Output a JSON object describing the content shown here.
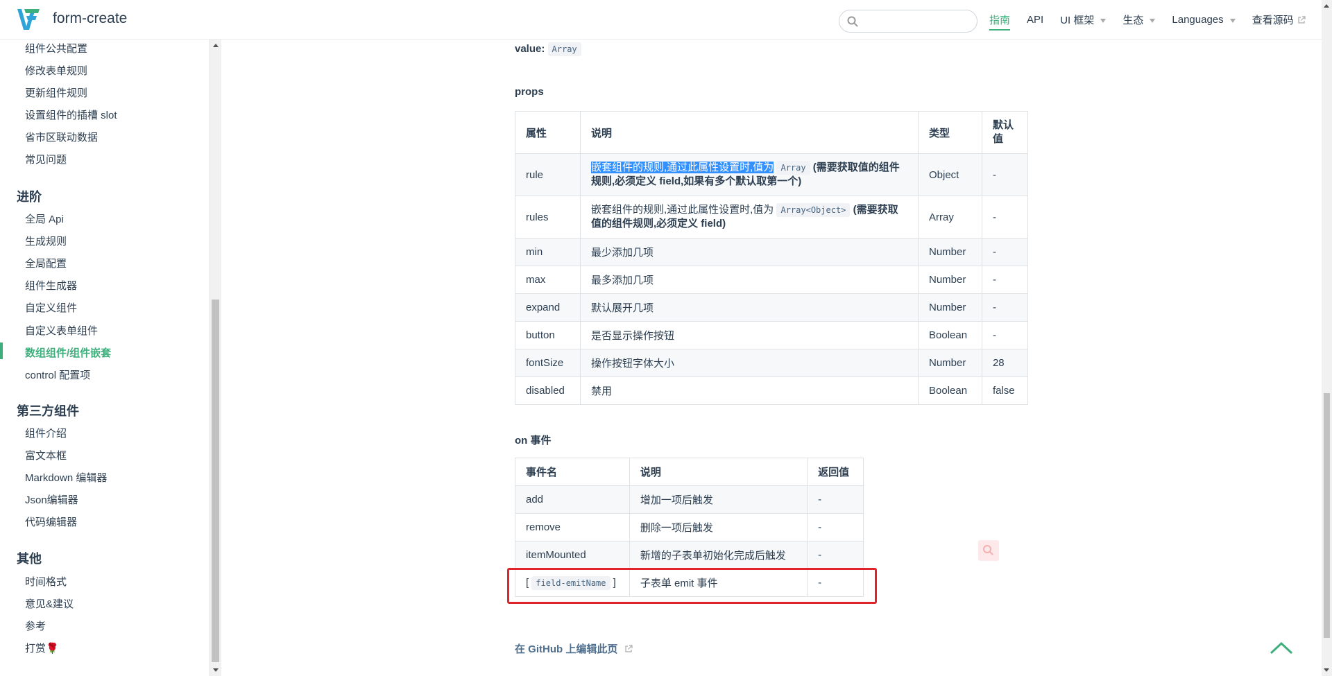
{
  "header": {
    "site_name": "form-create",
    "search_placeholder": "",
    "nav": [
      {
        "label": "指南",
        "active": true,
        "dropdown": false
      },
      {
        "label": "API",
        "active": false,
        "dropdown": false
      },
      {
        "label": "UI 框架",
        "active": false,
        "dropdown": true
      },
      {
        "label": "生态",
        "active": false,
        "dropdown": true
      },
      {
        "label": "Languages",
        "active": false,
        "dropdown": true
      },
      {
        "label": "查看源码",
        "active": false,
        "dropdown": false,
        "external": true
      }
    ]
  },
  "sidebar": {
    "items_top": [
      "组件公共配置",
      "修改表单规则",
      "更新组件规则",
      "设置组件的插槽 slot",
      "省市区联动数据",
      "常见问题"
    ],
    "group_advanced": "进阶",
    "items_advanced": [
      "全局 Api",
      "生成规则",
      "全局配置",
      "组件生成器",
      "自定义组件",
      "自定义表单组件",
      "数组组件/组件嵌套",
      "control 配置项"
    ],
    "active_item": "数组组件/组件嵌套",
    "group_third": "第三方组件",
    "items_third": [
      "组件介绍",
      "富文本框",
      "Markdown 编辑器",
      "Json编辑器",
      "代码编辑器"
    ],
    "group_other": "其他",
    "items_other": [
      "时间格式",
      "意见&建议",
      "参考",
      "打赏🌹"
    ]
  },
  "content": {
    "value_label": "value:",
    "value_type": "Array",
    "props_title": "props",
    "props_headers": [
      "属性",
      "说明",
      "类型",
      "默认值"
    ],
    "props_rows": [
      {
        "name": "rule",
        "desc_pre": "嵌套组件的规则,通过此属性设置时,值为",
        "desc_code": "Array",
        "desc_post": "(需要获取值的组件规则,必须定义 field,如果有多个默认取第一个)",
        "type": "Object",
        "default": "-"
      },
      {
        "name": "rules",
        "desc_pre": "嵌套组件的规则,通过此属性设置时,值为",
        "desc_code": "Array<Object>",
        "desc_post": "(需要获取值的组件规则,必须定义 field)",
        "type": "Array",
        "default": "-"
      },
      {
        "name": "min",
        "desc": "最少添加几项",
        "type": "Number",
        "default": "-"
      },
      {
        "name": "max",
        "desc": "最多添加几项",
        "type": "Number",
        "default": "-"
      },
      {
        "name": "expand",
        "desc": "默认展开几项",
        "type": "Number",
        "default": "-"
      },
      {
        "name": "button",
        "desc": "是否显示操作按钮",
        "type": "Boolean",
        "default": "-"
      },
      {
        "name": "fontSize",
        "desc": "操作按钮字体大小",
        "type": "Number",
        "default": "28"
      },
      {
        "name": "disabled",
        "desc": "禁用",
        "type": "Boolean",
        "default": "false"
      }
    ],
    "events_title": "on 事件",
    "events_headers": [
      "事件名",
      "说明",
      "返回值"
    ],
    "events_rows": [
      {
        "name": "add",
        "desc": "增加一项后触发",
        "ret": "-"
      },
      {
        "name": "remove",
        "desc": "删除一项后触发",
        "ret": "-"
      },
      {
        "name": "itemMounted",
        "desc": "新增的子表单初始化完成后触发",
        "ret": "-"
      },
      {
        "name_pre": "[",
        "name_code": "field-emitName",
        "name_post": "]",
        "desc": "子表单 emit 事件",
        "ret": "-"
      }
    ],
    "github_link": "在 GitHub 上编辑此页"
  },
  "colors": {
    "accent": "#3eaf7c",
    "highlight_box": "#e0242b",
    "selection": "#3390ff"
  },
  "icons": [
    "logo-icon",
    "search-icon",
    "external-link-icon",
    "back-to-top-icon"
  ]
}
